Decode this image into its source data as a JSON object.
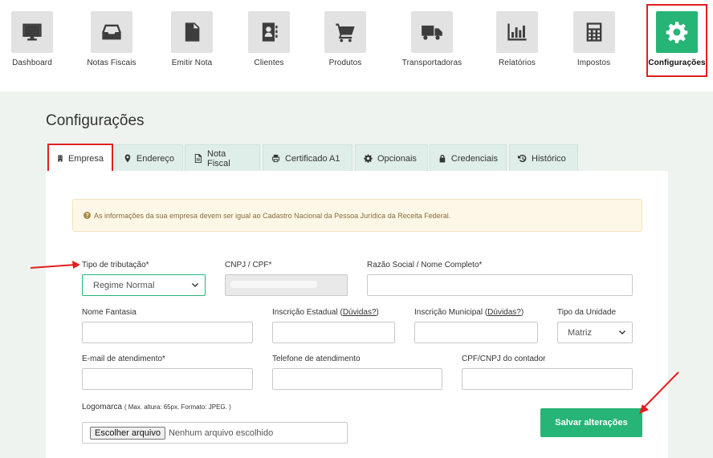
{
  "nav": {
    "items": [
      {
        "label": "Dashboard",
        "icon": "monitor-icon"
      },
      {
        "label": "Notas Fiscais",
        "icon": "inbox-icon"
      },
      {
        "label": "Emitir Nota",
        "icon": "document-icon"
      },
      {
        "label": "Clientes",
        "icon": "address-book-icon"
      },
      {
        "label": "Produtos",
        "icon": "cart-icon"
      },
      {
        "label": "Transportadoras",
        "icon": "truck-icon"
      },
      {
        "label": "Relatórios",
        "icon": "bar-chart-icon"
      },
      {
        "label": "Impostos",
        "icon": "calculator-icon"
      },
      {
        "label": "Configurações",
        "icon": "gear-icon"
      }
    ],
    "active": "Configurações"
  },
  "page": {
    "title": "Configurações"
  },
  "tabs": [
    {
      "label": "Empresa",
      "icon": "building-icon"
    },
    {
      "label": "Endereço",
      "icon": "map-marker-icon"
    },
    {
      "label": "Nota Fiscal",
      "icon": "file-icon"
    },
    {
      "label": "Certificado A1",
      "icon": "printer-icon"
    },
    {
      "label": "Opcionais",
      "icon": "gear-icon"
    },
    {
      "label": "Credenciais",
      "icon": "lock-icon"
    },
    {
      "label": "Histórico",
      "icon": "history-icon"
    }
  ],
  "alert": {
    "text": "As informações da sua empresa devem ser igual ao Cadastro Nacional da Pessoa Jurídica da Receita Federal."
  },
  "form": {
    "tipo_tributacao": {
      "label": "Tipo de tributação*",
      "value": "Regime Normal"
    },
    "cnpj_cpf": {
      "label": "CNPJ / CPF*"
    },
    "razao_social": {
      "label": "Razão Social / Nome Completo*",
      "value": ""
    },
    "nome_fantasia": {
      "label": "Nome Fantasia",
      "value": ""
    },
    "inscricao_estadual": {
      "label": "Inscrição Estadual (",
      "link": "Dúvidas?",
      "suffix": ")",
      "value": ""
    },
    "inscricao_municipal": {
      "label": "Inscrição Municipal (",
      "link": "Dúvidas?",
      "suffix": ")",
      "value": ""
    },
    "tipo_unidade": {
      "label": "Tipo da Unidade",
      "value": "Matriz"
    },
    "email_atendimento": {
      "label": "E-mail de atendimento*",
      "value": ""
    },
    "telefone_atendimento": {
      "label": "Telefone de atendimento",
      "value": ""
    },
    "cpf_cnpj_contador": {
      "label": "CPF/CNPJ do contador",
      "value": ""
    },
    "logomarca": {
      "label": "Logomarca",
      "hint": "( Max. altura: 65px. Formato: JPEG. )",
      "button": "Escolher arquivo",
      "status": "Nenhum arquivo escolhido"
    },
    "save_label": "Salvar alterações"
  },
  "colors": {
    "accent": "#27b477",
    "highlight": "#e0201f",
    "alert_bg": "#fcf7e6"
  }
}
